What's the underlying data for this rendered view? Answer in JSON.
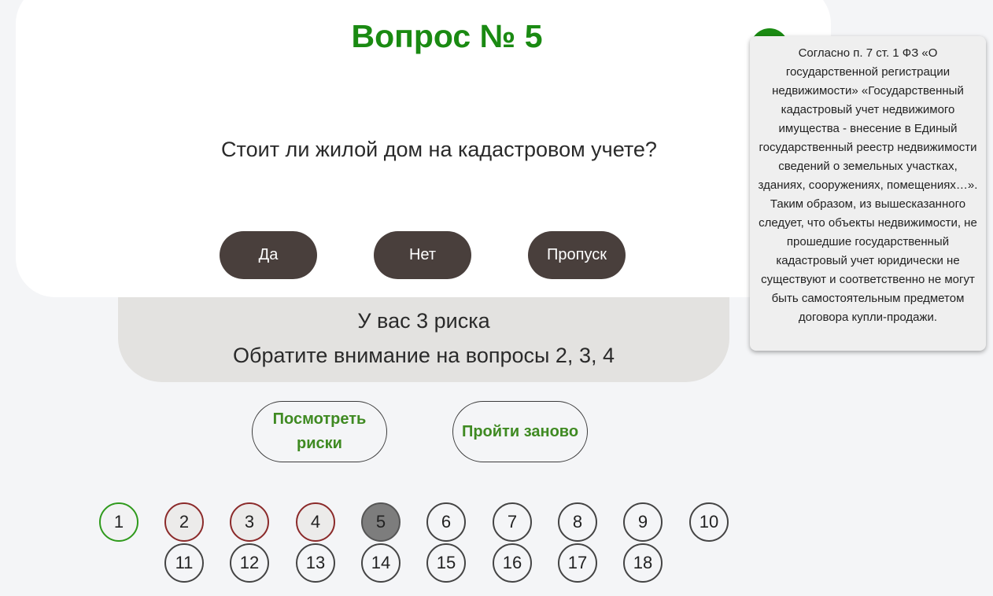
{
  "question": {
    "title": "Вопрос № 5",
    "text": "Стоит ли жилой дом на кадастровом учете?",
    "answers": {
      "yes": "Да",
      "no": "Нет",
      "skip": "Пропуск"
    }
  },
  "risks": {
    "summary": "У вас 3 риска",
    "attention": "Обратите внимание на вопросы 2, 3, 4"
  },
  "actions": {
    "view_risks": "Посмотреть риски",
    "restart": "Пройти заново"
  },
  "hint": {
    "icon": "help-icon",
    "text": "Согласно п. 7 ст. 1 ФЗ «О государственной регистрации недвижимости» «Государственный кадастровый учет недвижимого имущества - внесение в Единый государственный реестр недвижимости сведений о земельных участках, зданиях, сооружениях, помещениях…». Таким образом, из вышесказанного следует, что объекты недвижимости, не прошедшие государственный кадастровый учет юридически не существуют и соответственно не могут быть самостоятельным предметом договора купли-продажи."
  },
  "navigator": {
    "items": [
      {
        "label": "1",
        "status": "ok"
      },
      {
        "label": "2",
        "status": "risk"
      },
      {
        "label": "3",
        "status": "risk"
      },
      {
        "label": "4",
        "status": "risk"
      },
      {
        "label": "5",
        "status": "current"
      },
      {
        "label": "6",
        "status": "pending"
      },
      {
        "label": "7",
        "status": "pending"
      },
      {
        "label": "8",
        "status": "pending"
      },
      {
        "label": "9",
        "status": "pending"
      },
      {
        "label": "10",
        "status": "pending"
      },
      {
        "label": "11",
        "status": "pending"
      },
      {
        "label": "12",
        "status": "pending"
      },
      {
        "label": "13",
        "status": "pending"
      },
      {
        "label": "14",
        "status": "pending"
      },
      {
        "label": "15",
        "status": "pending"
      },
      {
        "label": "16",
        "status": "pending"
      },
      {
        "label": "17",
        "status": "pending"
      },
      {
        "label": "18",
        "status": "pending"
      }
    ]
  },
  "colors": {
    "accent_green": "#1a8a12",
    "risk_red": "#8b2a2a",
    "button_dark": "#493f3c"
  }
}
